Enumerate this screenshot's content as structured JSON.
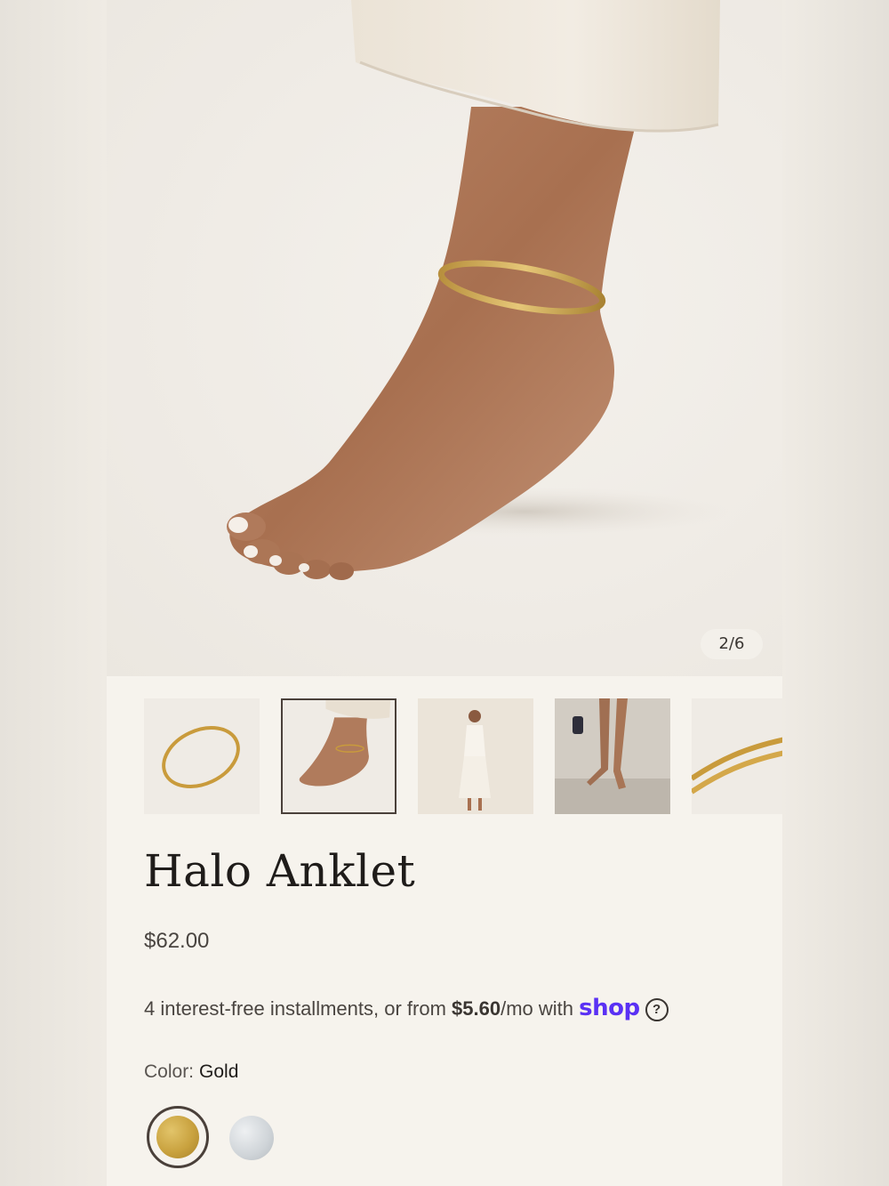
{
  "gallery": {
    "counter": "2/6",
    "main_image": "model-foot-wearing-gold-anklet",
    "thumbnails": [
      {
        "name": "thumb-anklet-product",
        "depicts": "gold anklet ring",
        "selected": false
      },
      {
        "name": "thumb-anklet-on-foot",
        "depicts": "foot wearing anklet",
        "selected": true
      },
      {
        "name": "thumb-model-white-dress",
        "depicts": "model in white outfit",
        "selected": false
      },
      {
        "name": "thumb-legs-sandals",
        "depicts": "legs wearing sandals",
        "selected": false
      },
      {
        "name": "thumb-anklet-closeup",
        "depicts": "anklet clasp closeup",
        "selected": false
      }
    ]
  },
  "product": {
    "title": "Halo Anklet",
    "price": "$62.00"
  },
  "installments": {
    "prefix": "4 interest-free installments, or from ",
    "amount": "$5.60",
    "suffix": "/mo with ",
    "provider": "shop",
    "help": "?"
  },
  "color": {
    "label": "Color:",
    "selected": "Gold",
    "options": [
      {
        "name": "Gold",
        "hex": "#c9a23f",
        "selected": true
      },
      {
        "name": "Silver",
        "hex": "#cfd4d8",
        "selected": false
      }
    ]
  },
  "colors": {
    "background": "#f6f3ed",
    "text": "#1f1c1a",
    "shop_brand": "#5a31f4",
    "selected_border": "#4a403a"
  }
}
